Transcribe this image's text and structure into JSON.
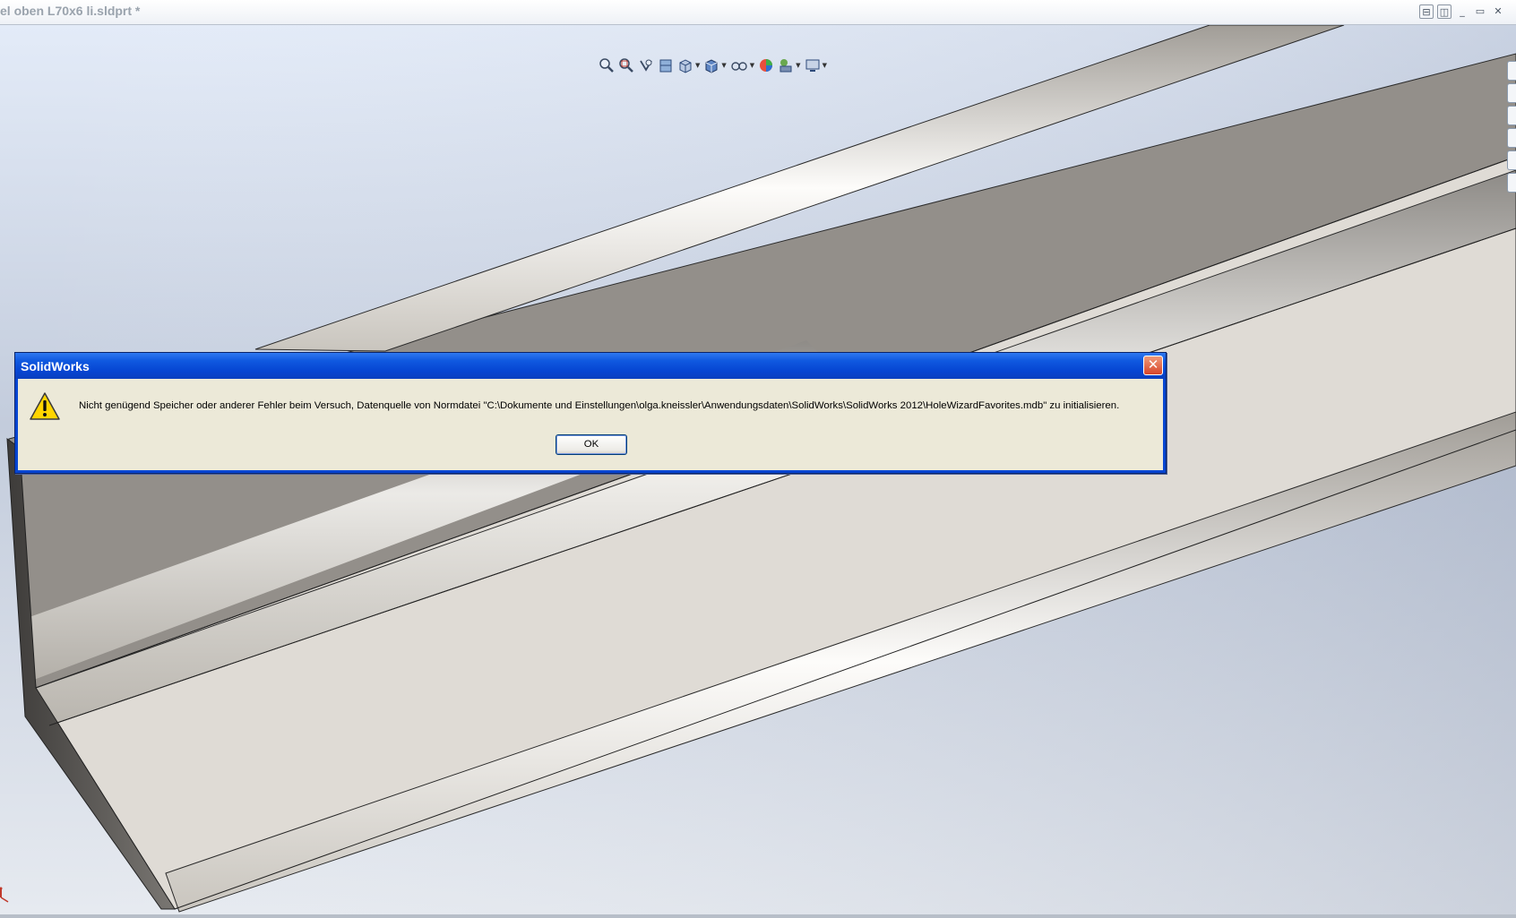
{
  "document": {
    "title": "el oben L70x6 li.sldprt *"
  },
  "window_controls": {
    "tile_horizontal": "⊟",
    "tile_vertical": "◫",
    "minimize": "_",
    "restore": "▭",
    "close": "✕"
  },
  "heads_up_toolbar": {
    "tools": [
      "zoom-to-fit-icon",
      "zoom-to-area-icon",
      "previous-view-icon",
      "section-view-icon",
      "view-orientation-icon",
      "display-style-icon",
      "hide-show-items-icon",
      "edit-appearance-icon",
      "apply-scene-icon",
      "view-settings-icon"
    ]
  },
  "dialog": {
    "title": "SolidWorks",
    "icon": "warning-icon",
    "message": "Nicht genügend Speicher oder anderer Fehler beim Versuch, Datenquelle von Normdatei \"C:\\Dokumente und Einstellungen\\olga.kneissler\\Anwendungsdaten\\SolidWorks\\SolidWorks 2012\\HoleWizardFavorites.mdb\" zu initialisieren.",
    "ok_label": "OK",
    "close_symbol": "✕"
  },
  "colors": {
    "dialog_title_blue": "#0645d2",
    "dialog_body": "#ece9d8",
    "viewport_top": "#dde6f3",
    "viewport_bottom": "#8e9ab0",
    "part_face_light": "#dedad4",
    "part_face_dark": "#918d88"
  }
}
